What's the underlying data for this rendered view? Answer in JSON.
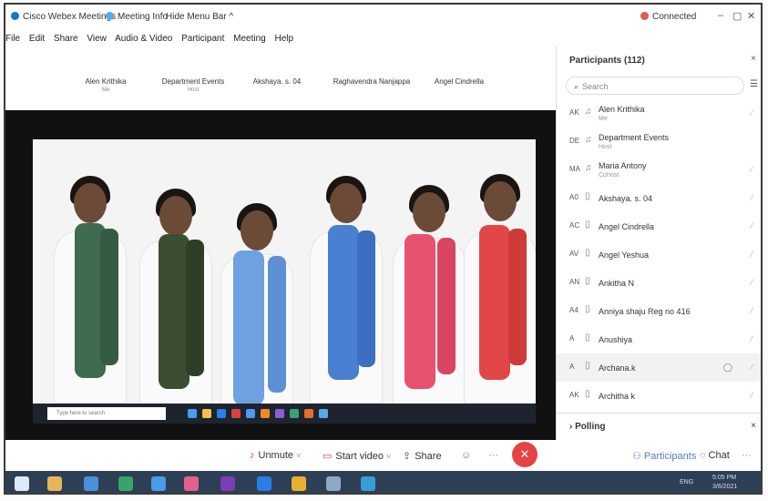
{
  "titlebar": {
    "app_title": "Cisco Webex Meetings",
    "meeting_info": "Meeting Info",
    "hide_menu": "Hide Menu Bar ^",
    "connection": "Connected",
    "minimize": "–",
    "restore": "▢",
    "close": "✕"
  },
  "menu": [
    "File",
    "Edit",
    "Share",
    "View",
    "Audio & Video",
    "Participant",
    "Meeting",
    "Help"
  ],
  "strip": [
    {
      "name": "Alen Krithika",
      "role": "Me"
    },
    {
      "name": "Department Events",
      "role": "Host"
    },
    {
      "name": "Akshaya. s. 04",
      "role": ""
    },
    {
      "name": "Raghavendra Nanjappa",
      "role": ""
    },
    {
      "name": "Angel Cindrella",
      "role": ""
    }
  ],
  "inner_taskbar": {
    "search_placeholder": "Type here to search"
  },
  "controls": {
    "unmute": "Unmute",
    "start_video": "Start video",
    "share": "Share",
    "end": "✕",
    "participants": "Participants",
    "chat": "Chat",
    "more": "···"
  },
  "panel": {
    "title": "Participants (112)",
    "close": "×",
    "search_placeholder": "Search",
    "participants": [
      {
        "abbr": "AK",
        "name": "Alen Krithika",
        "role": "Me"
      },
      {
        "abbr": "DE",
        "name": "Department Events",
        "role": "Host"
      },
      {
        "abbr": "MA",
        "name": "Maria Antony",
        "role": "Cohost"
      },
      {
        "abbr": "A0",
        "name": "Akshaya. s. 04",
        "role": ""
      },
      {
        "abbr": "AC",
        "name": "Angel Cindrella",
        "role": ""
      },
      {
        "abbr": "AV",
        "name": "Angel Yeshua",
        "role": ""
      },
      {
        "abbr": "AN",
        "name": "Ankitha N",
        "role": ""
      },
      {
        "abbr": "A4",
        "name": "Anniya shaju Reg no 416",
        "role": ""
      },
      {
        "abbr": "A",
        "name": "Anushiya",
        "role": ""
      },
      {
        "abbr": "A",
        "name": "Archana.k",
        "role": ""
      },
      {
        "abbr": "AK",
        "name": "Architha k",
        "role": ""
      }
    ],
    "polling_title": "Polling",
    "polling_close": "×"
  },
  "taskbar": {
    "time": "5:05 PM",
    "date": "3/6/2021",
    "lang": "ENG"
  },
  "colors": {
    "accent": "#1a73c9",
    "end_call": "#e44444",
    "taskbar": "#2d3f55"
  }
}
